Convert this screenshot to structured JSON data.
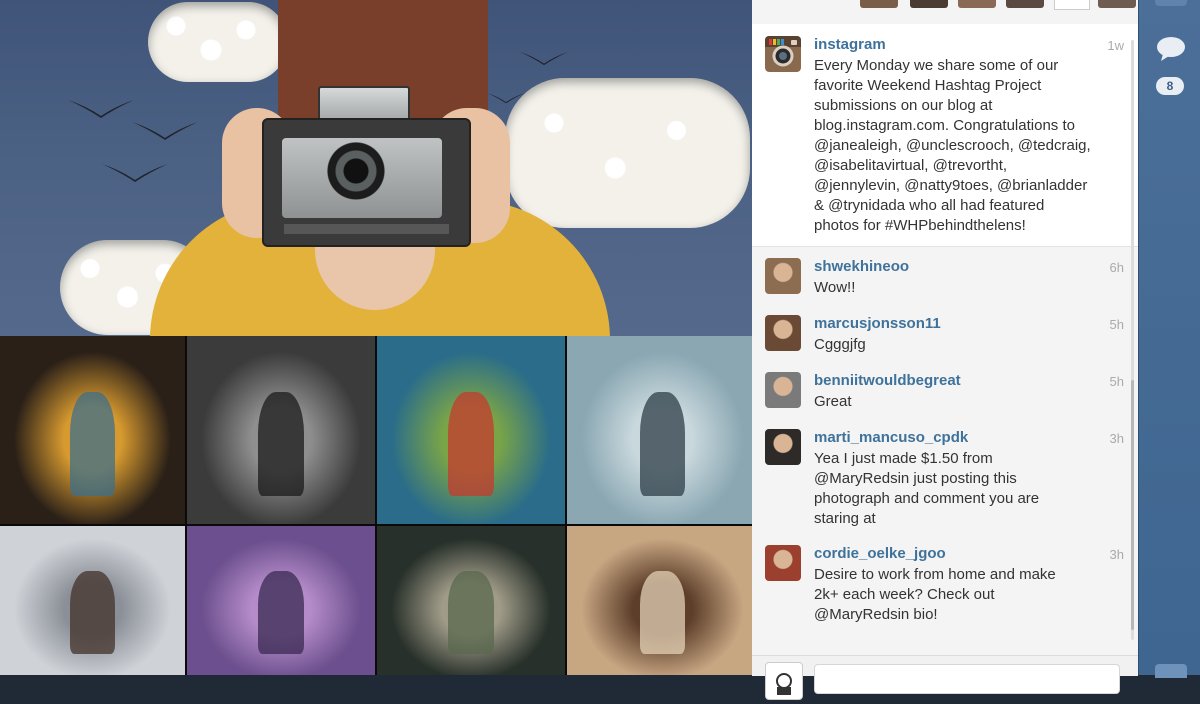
{
  "hero": {
    "colors": {
      "wall": "#4b6184",
      "sweater": "#e2b23a",
      "hair": "#7a3f2a",
      "camera": "#3b3a3a"
    }
  },
  "grid": {
    "tiles": [
      {
        "name": "golden-figure-photo",
        "colors": [
          "#2a2018",
          "#d79a2f",
          "#3e6f8a"
        ]
      },
      {
        "name": "bearded-man-owl-photo",
        "colors": [
          "#3b3b3b",
          "#8f8f8f",
          "#1b1b1b"
        ]
      },
      {
        "name": "snake-plant-photo",
        "colors": [
          "#2a6c8a",
          "#79a448",
          "#c43b2d"
        ]
      },
      {
        "name": "bridge-jump-photo",
        "colors": [
          "#8aa7b2",
          "#c9d8dd",
          "#2d3e47"
        ]
      },
      {
        "name": "snowy-road-photo",
        "colors": [
          "#cfd3d8",
          "#8b8f97",
          "#43312a"
        ]
      },
      {
        "name": "purple-leaves-face-photo",
        "colors": [
          "#6c4f8e",
          "#b58cc9",
          "#3a2a52"
        ]
      },
      {
        "name": "rainy-window-photo",
        "colors": [
          "#27302a",
          "#a09b88",
          "#59684e"
        ]
      },
      {
        "name": "antler-creature-photo",
        "colors": [
          "#c7a682",
          "#5c3e2a",
          "#e3d0b5"
        ]
      }
    ]
  },
  "caption": {
    "username": "instagram",
    "time": "1w",
    "text": "Every Monday we share some of our\nfavorite Weekend Hashtag Project\nsubmissions on our blog at\nblog.instagram.com. Congratulations to\n@janealeigh, @unclescrooch, @tedcraig,\n@isabelitavirtual, @trevortht,\n@jennylevin, @natty9toes, @brianladder\n& @trynidada who all had featured\nphotos for #WHPbehindthelens!"
  },
  "comments": [
    {
      "username": "shwekhineoo",
      "time": "6h",
      "text": "Wow!!",
      "avatar_color": "#8c6d52"
    },
    {
      "username": "marcusjonsson11",
      "time": "5h",
      "text": "Cgggjfg",
      "avatar_color": "#6a4a34"
    },
    {
      "username": "benniitwouldbegreat",
      "time": "5h",
      "text": "Great",
      "avatar_color": "#7a7a7a"
    },
    {
      "username": "marti_mancuso_cpdk",
      "time": "3h",
      "text": "Yea I just made $1.50 from\n@MaryRedsin just posting this\nphotograph and comment you are\nstaring at",
      "avatar_color": "#2e2a27"
    },
    {
      "username": "cordie_oelke_jgoo",
      "time": "3h",
      "text": "Desire to work from home and make\n2k+ each week? Check out\n@MaryRedsin bio!",
      "avatar_color": "#9b3f2f"
    }
  ],
  "rail": {
    "comment_icon": "speech-bubble-icon",
    "comment_count": "8"
  },
  "compose": {
    "placeholder": ""
  },
  "colors": {
    "username": "#3f729b",
    "rail": "#4b6f98",
    "panel": "#f4f4f4"
  }
}
